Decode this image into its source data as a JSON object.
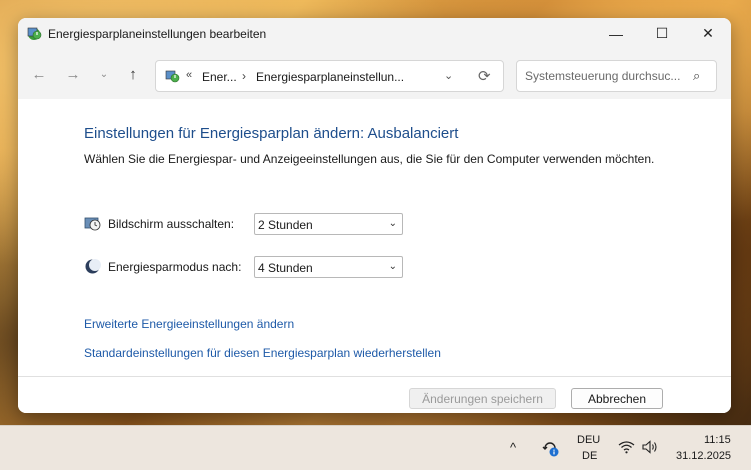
{
  "window": {
    "title": "Energiesparplaneinstellungen bearbeiten",
    "minimize": "—",
    "maximize": "☐",
    "close": "✕"
  },
  "nav": {
    "back": "←",
    "forward": "→",
    "recent": "⌄",
    "up": "↑"
  },
  "address": {
    "chevron": "«",
    "segment1": "Ener...",
    "separator": "›",
    "segment2": "Energiesparplaneinstellun...",
    "dropdown": "⌄",
    "refresh": "⟳"
  },
  "search": {
    "placeholder": "Systemsteuerung durchsuc...",
    "icon": "⌕"
  },
  "main": {
    "title": "Einstellungen für Energiesparplan ändern: Ausbalanciert",
    "subtitle": "Wählen Sie die Energiespar- und Anzeigeeinstellungen aus, die Sie für den Computer verwenden möchten.",
    "settings": [
      {
        "label": "Bildschirm ausschalten:",
        "value": "2 Stunden",
        "icon": "monitor-clock-icon"
      },
      {
        "label": "Energiesparmodus nach:",
        "value": "4 Stunden",
        "icon": "moon-icon"
      }
    ],
    "select_arrow": "⌄",
    "links": [
      "Erweiterte Energieeinstellungen ändern",
      "Standardeinstellungen für diesen Energiesparplan wiederherstellen"
    ]
  },
  "buttons": {
    "save": "Änderungen speichern",
    "cancel": "Abbrechen"
  },
  "taskbar": {
    "chevron": "^",
    "lang_line1": "DEU",
    "lang_line2": "DE",
    "time": "11:15",
    "date": "31.12.2025"
  },
  "colors": {
    "title_blue": "#1e4e8c",
    "link_blue": "#1e5aa8",
    "window_bg": "#ffffff",
    "chrome_bg": "#f3f3f3",
    "taskbar_bg": "#ede6de"
  }
}
